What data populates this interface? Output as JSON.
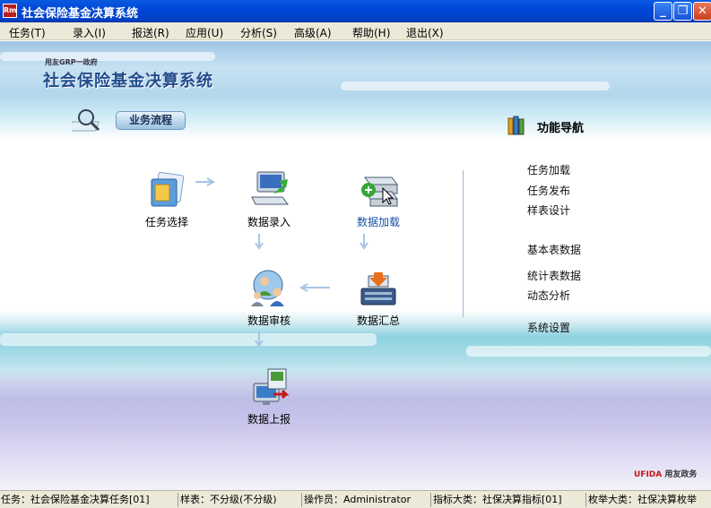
{
  "window": {
    "title": "社会保险基金决算系统",
    "icon_text": "Rm",
    "buttons": {
      "minimize": "_",
      "restore": "❐",
      "close": "✕"
    }
  },
  "menu": [
    {
      "label": "任务(T)"
    },
    {
      "label": "录入(I)"
    },
    {
      "label": "报送(R)"
    },
    {
      "label": "应用(U)"
    },
    {
      "label": "分析(S)"
    },
    {
      "label": "高级(A)"
    },
    {
      "label": "帮助(H)"
    },
    {
      "label": "退出(X)"
    }
  ],
  "banner": {
    "logo_small": "用友GRP一政府",
    "system_title": "社会保险基金决算系统"
  },
  "workflow": {
    "section_title": "业务流程",
    "nodes": {
      "task_select": "任务选择",
      "data_entry": "数据录入",
      "data_load": "数据加载",
      "data_review": "数据审核",
      "data_summary": "数据汇总",
      "data_report": "数据上报"
    }
  },
  "nav": {
    "title": "功能导航",
    "links": {
      "task_load": "任务加载",
      "task_publish": "任务发布",
      "template_design": "样表设计",
      "basic_table_data": "基本表数据",
      "stats_table_data": "统计表数据",
      "dynamic_analysis": "动态分析",
      "system_settings": "系统设置"
    }
  },
  "brand": {
    "name": "UFIDA",
    "suffix": "用友政务"
  },
  "status": {
    "task": "任务：社会保险基金决算任务[01]",
    "template": "样表：不分级(不分级)",
    "operator": "操作员：Administrator",
    "indicator": "指标大类：社保决算指标[01]",
    "enum": "枚举大类：社保决算枚举"
  },
  "colors": {
    "titlebar": "#0046d8",
    "menubar": "#ece9d8",
    "active_label": "#1653a6"
  }
}
